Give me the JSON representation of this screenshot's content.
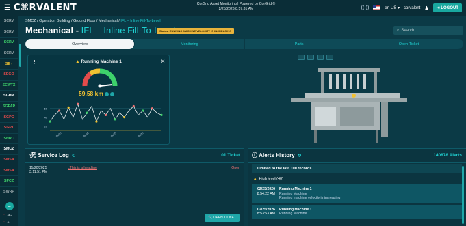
{
  "header": {
    "logo": "C⌘RVALENT",
    "center_line1": "CorGrid Asset Monitoring | Powered by CorGrid ®",
    "center_line2": "2/25/2026 8:57:31 AM",
    "locale": "en-US ▾",
    "user": "corvalent",
    "logout": "LOGOUT"
  },
  "sidebar": {
    "items": [
      {
        "label": "SCRV",
        "color": "#9aa9ad"
      },
      {
        "label": "SCRV",
        "color": "#9aa9ad"
      },
      {
        "label": "SCRV",
        "color": "#3ed16b"
      },
      {
        "label": "SCRV",
        "color": "#9aa9ad"
      },
      {
        "label": "SE -",
        "color": "#f1c232"
      },
      {
        "label": "SEGO",
        "color": "#e34b4b"
      },
      {
        "label": "SEWTX",
        "color": "#3ed16b"
      },
      {
        "label": "SGHM",
        "color": "#ffffff"
      },
      {
        "label": "SGPAP",
        "color": "#3ed16b"
      },
      {
        "label": "SGPC",
        "color": "#e34b4b"
      },
      {
        "label": "SGPT",
        "color": "#e34b4b"
      },
      {
        "label": "SHRC",
        "color": "#3ed16b"
      },
      {
        "label": "SMCZ",
        "color": "#ffffff"
      },
      {
        "label": "SMSA",
        "color": "#e34b4b"
      },
      {
        "label": "SMSA",
        "color": "#e34b4b"
      },
      {
        "label": "SPCZ",
        "color": "#3ed16b"
      },
      {
        "label": "SWRP",
        "color": "#9aa9ad"
      }
    ],
    "stat1": "362",
    "stat2": "37"
  },
  "breadcrumb": {
    "path": "SMCZ / Operation Building / Ground Floor / Mechanical / ",
    "current": "IFL – Inline Fill-To-Level"
  },
  "title": {
    "main": "Mechanical - ",
    "sub": "IFL – Inline Fill-To-Level"
  },
  "status_badge": "Status: RUNNING MACHINE VELOCITY IS INCREASING",
  "search": {
    "placeholder": "Search"
  },
  "tabs": [
    "Overview",
    "Monitoring",
    "Parts",
    "Open Ticket"
  ],
  "machine_card": {
    "title": "Running Machine 1",
    "value": "59.58 km"
  },
  "chart_data": {
    "type": "line",
    "x": [
      "08:05",
      "08:15",
      "08:25",
      "08:35"
    ],
    "values": [
      30,
      45,
      55,
      35,
      62,
      40,
      70,
      35,
      50,
      65,
      30,
      55,
      45,
      60,
      35,
      50,
      40,
      55,
      65,
      45,
      55,
      40,
      60,
      50,
      45
    ],
    "yticks": [
      20,
      40,
      60
    ],
    "ylim": [
      10,
      75
    ],
    "markers": [
      {
        "i": 0,
        "color": "#3ed16b"
      },
      {
        "i": 2,
        "color": "#f07373"
      },
      {
        "i": 4,
        "color": "#f1c232"
      },
      {
        "i": 6,
        "color": "#f07373"
      },
      {
        "i": 8,
        "color": "#3ed16b"
      },
      {
        "i": 10,
        "color": "#f1c232"
      },
      {
        "i": 12,
        "color": "#f07373"
      },
      {
        "i": 14,
        "color": "#3ed16b"
      },
      {
        "i": 16,
        "color": "#f1c232"
      },
      {
        "i": 18,
        "color": "#f07373"
      },
      {
        "i": 20,
        "color": "#3ed16b"
      },
      {
        "i": 22,
        "color": "#f07373"
      },
      {
        "i": 24,
        "color": "#3ed16b"
      }
    ]
  },
  "service_log": {
    "title": "Service Log",
    "count": "01 Ticket",
    "rows": [
      {
        "date": "11/20/2025",
        "time": "3:11:51 PM",
        "link": "cThis is a headline",
        "status": "Open"
      }
    ],
    "open_ticket": "OPEN TICKET"
  },
  "alerts": {
    "title": "Alerts History",
    "count": "140878 Alerts",
    "limited": "Limited to the last 100 records",
    "level": "High level (40)",
    "items": [
      {
        "date": "02/25/2026",
        "time": "8:54:22 AM",
        "name": "Running Machine 1",
        "l1": "Running Machine",
        "l2": "Running machine velocity is increasing"
      },
      {
        "date": "02/25/2026",
        "time": "8:53:53 AM",
        "name": "Running Machine 1",
        "l1": "Running Machine",
        "l2": ""
      }
    ]
  }
}
